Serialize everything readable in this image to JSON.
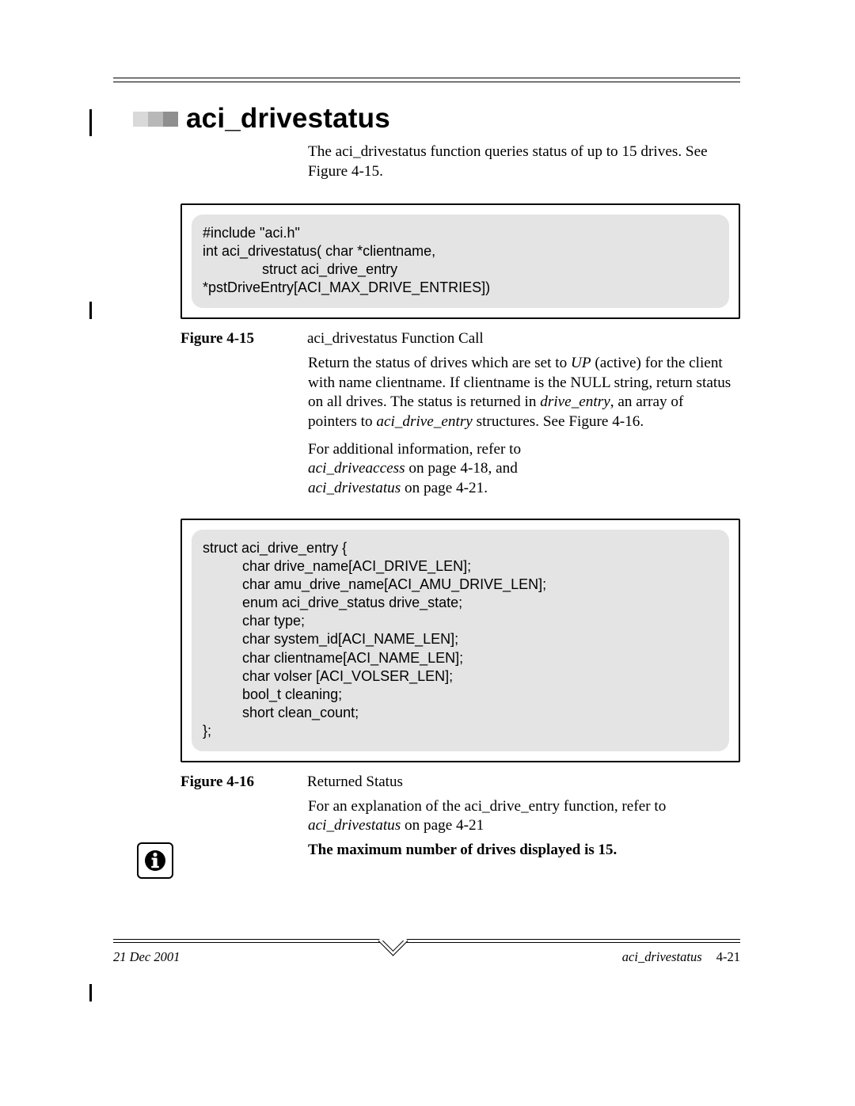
{
  "heading": "aci_drivestatus",
  "intro": "The aci_drivestatus function queries status of up to 15 drives. See Figure 4-15.",
  "code1": "#include \"aci.h\"\nint aci_drivestatus( char *clientname,\n               struct aci_drive_entry\n*pstDriveEntry[ACI_MAX_DRIVE_ENTRIES])",
  "fig1": {
    "label": "Figure 4-15",
    "caption": "aci_drivestatus Function Call"
  },
  "para1_a": "Return the status of drives which are set to ",
  "para1_up": "UP",
  "para1_b": " (active) for the client with name clientname. If clientname is the NULL string, return status on all drives. The status is returned in ",
  "para1_de": "drive_entry",
  "para1_c": ", an array of pointers to ",
  "para1_ade": "aci_drive_entry",
  "para1_d": " structures. See Figure 4-16.",
  "para2_a": "For additional information, refer to",
  "para2_ref1": "aci_driveaccess",
  "para2_ref1_pg": "  on page 4-18, and",
  "para2_ref2": "aci_drivestatus",
  "para2_ref2_pg": "  on page 4-21.",
  "code2": "struct aci_drive_entry {\n          char drive_name[ACI_DRIVE_LEN];\n          char amu_drive_name[ACI_AMU_DRIVE_LEN];\n          enum aci_drive_status drive_state;\n          char type;\n          char system_id[ACI_NAME_LEN];\n          char clientname[ACI_NAME_LEN];\n          char volser [ACI_VOLSER_LEN];\n          bool_t cleaning;\n          short clean_count;\n};",
  "fig2": {
    "label": "Figure 4-16",
    "caption": "Returned Status"
  },
  "para3_a": "For an explanation of the aci_drive_entry function, refer to ",
  "para3_ref": "aci_drivestatus",
  "para3_pg": "  on page 4-21",
  "infonote": "The maximum number of drives displayed is 15.",
  "footer": {
    "date": "21 Dec 2001",
    "section": "aci_drivestatus",
    "page": "4-21"
  }
}
